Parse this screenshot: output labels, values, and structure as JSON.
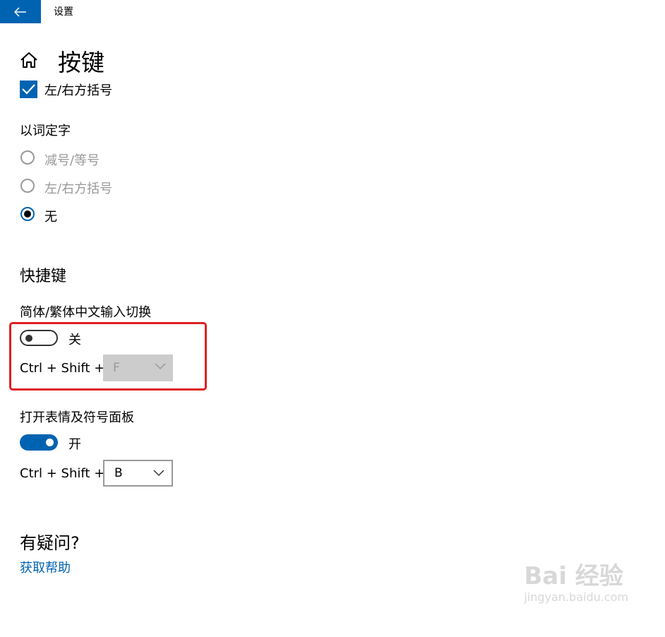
{
  "titlebar": {
    "title": "设置"
  },
  "page": {
    "title": "按键"
  },
  "checkbox_brackets": {
    "label": "左/右方括号",
    "checked": true
  },
  "word_select": {
    "heading": "以词定字",
    "options": [
      {
        "label": "减号/等号",
        "checked": false,
        "disabled": true
      },
      {
        "label": "左/右方括号",
        "checked": false,
        "disabled": true
      },
      {
        "label": "无",
        "checked": true,
        "disabled": false
      }
    ]
  },
  "shortcuts": {
    "heading": "快捷键",
    "simp_trad": {
      "label": "简体/繁体中文输入切换",
      "toggle_state": "关",
      "toggle_on": false,
      "combo_prefix": "Ctrl + Shift +",
      "key": "F",
      "key_disabled": true
    },
    "emoji_panel": {
      "label": "打开表情及符号面板",
      "toggle_state": "开",
      "toggle_on": true,
      "combo_prefix": "Ctrl + Shift +",
      "key": "B",
      "key_disabled": false
    }
  },
  "help": {
    "heading": "有疑问?",
    "link": "获取帮助"
  },
  "watermark": {
    "logo": "Bai 经验",
    "url": "jingyan.baidu.com"
  },
  "colors": {
    "accent": "#0063b1",
    "highlight": "#e02020"
  }
}
